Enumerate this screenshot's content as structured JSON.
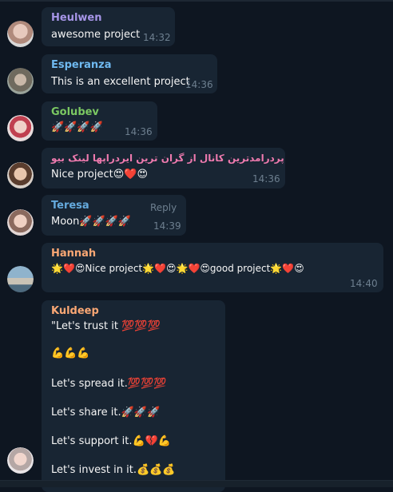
{
  "messages": [
    {
      "sender": "Heulwen",
      "name_color": "#a695e7",
      "text": "awesome project",
      "time": "14:32"
    },
    {
      "sender": "Esperanza",
      "name_color": "#6fb9f0",
      "text": "This is an excellent project",
      "time": "14:36"
    },
    {
      "sender": "Golubev",
      "name_color": "#7bc862",
      "text": "🚀🚀🚀🚀",
      "time": "14:36"
    },
    {
      "sender": "پردرامدترین کانال از گران ترین ایردراپها لینک بیو",
      "name_color": "#ee7aae",
      "text": "Nice project😍❤️😍",
      "time": "14:36"
    },
    {
      "sender": "Teresa",
      "name_color": "#65aadd",
      "text": "Moon🚀🚀🚀🚀",
      "time": "14:39",
      "action": "Reply"
    },
    {
      "sender": "Hannah",
      "name_color": "#faa774",
      "text": "🌟❤️😍Nice project🌟❤️😍🌟❤️😍good project🌟❤️😍",
      "time": "14:40"
    },
    {
      "sender": "Kuldeep",
      "name_color": "#faa774",
      "lines": [
        "\"Let's trust it 💯💯💯",
        "💪💪💪",
        "Let's spread it.💯💯💯",
        "Let's share it.🚀🚀🚀",
        "Let's support it.💪💔💪",
        "Let's invest in it.💰💰💰"
      ]
    }
  ],
  "colors": {
    "background": "#0e1621",
    "bubble": "#182533",
    "time": "#6d7f8f"
  }
}
